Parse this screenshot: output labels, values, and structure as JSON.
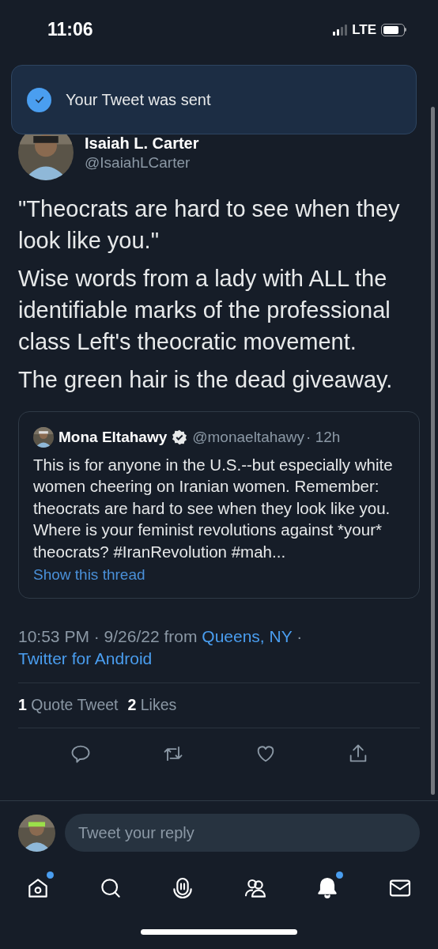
{
  "status_bar": {
    "time": "11:06",
    "network": "LTE"
  },
  "toast": {
    "message": "Your Tweet was sent"
  },
  "tweet": {
    "author_name": "Isaiah L. Carter",
    "author_handle": "@IsaiahLCarter",
    "paragraphs": [
      "\"Theocrats are hard to see when they look like you.\"",
      "Wise words from a lady with ALL the identifiable marks of the professional class Left's theocratic movement.",
      "The green hair is the dead giveaway."
    ],
    "quoted": {
      "author_name": "Mona Eltahawy",
      "verified": true,
      "author_handle": "@monaeltahawy",
      "time": "· 12h",
      "text": "This is for anyone in the U.S.--but especially white women cheering on Iranian women. Remember: theocrats are hard to see when they look like you. Where is your feminist revolutions against *your* theocrats? #IranRevolution #mah...",
      "thread_link": "Show this thread"
    },
    "meta": [
      {
        "kind": "plain",
        "text": "10:53 PM · 9/26/22 from"
      },
      {
        "kind": "link",
        "text": "Queens, NY"
      },
      {
        "kind": "plain",
        "text": "·"
      },
      {
        "kind": "link",
        "text": "Twitter for Android"
      }
    ],
    "stats": [
      {
        "count": "1",
        "label": "Quote Tweet"
      },
      {
        "count": "2",
        "label": "Likes"
      }
    ]
  },
  "reply": {
    "placeholder": "Tweet your reply"
  },
  "nav": [
    {
      "kind": "home",
      "selected": false,
      "dot": true
    },
    {
      "kind": "search",
      "selected": false,
      "dot": false
    },
    {
      "kind": "spaces",
      "selected": false,
      "dot": false
    },
    {
      "kind": "communities",
      "selected": false,
      "dot": false
    },
    {
      "kind": "notifications",
      "selected": true,
      "dot": true
    },
    {
      "kind": "messages",
      "selected": false,
      "dot": false
    }
  ]
}
